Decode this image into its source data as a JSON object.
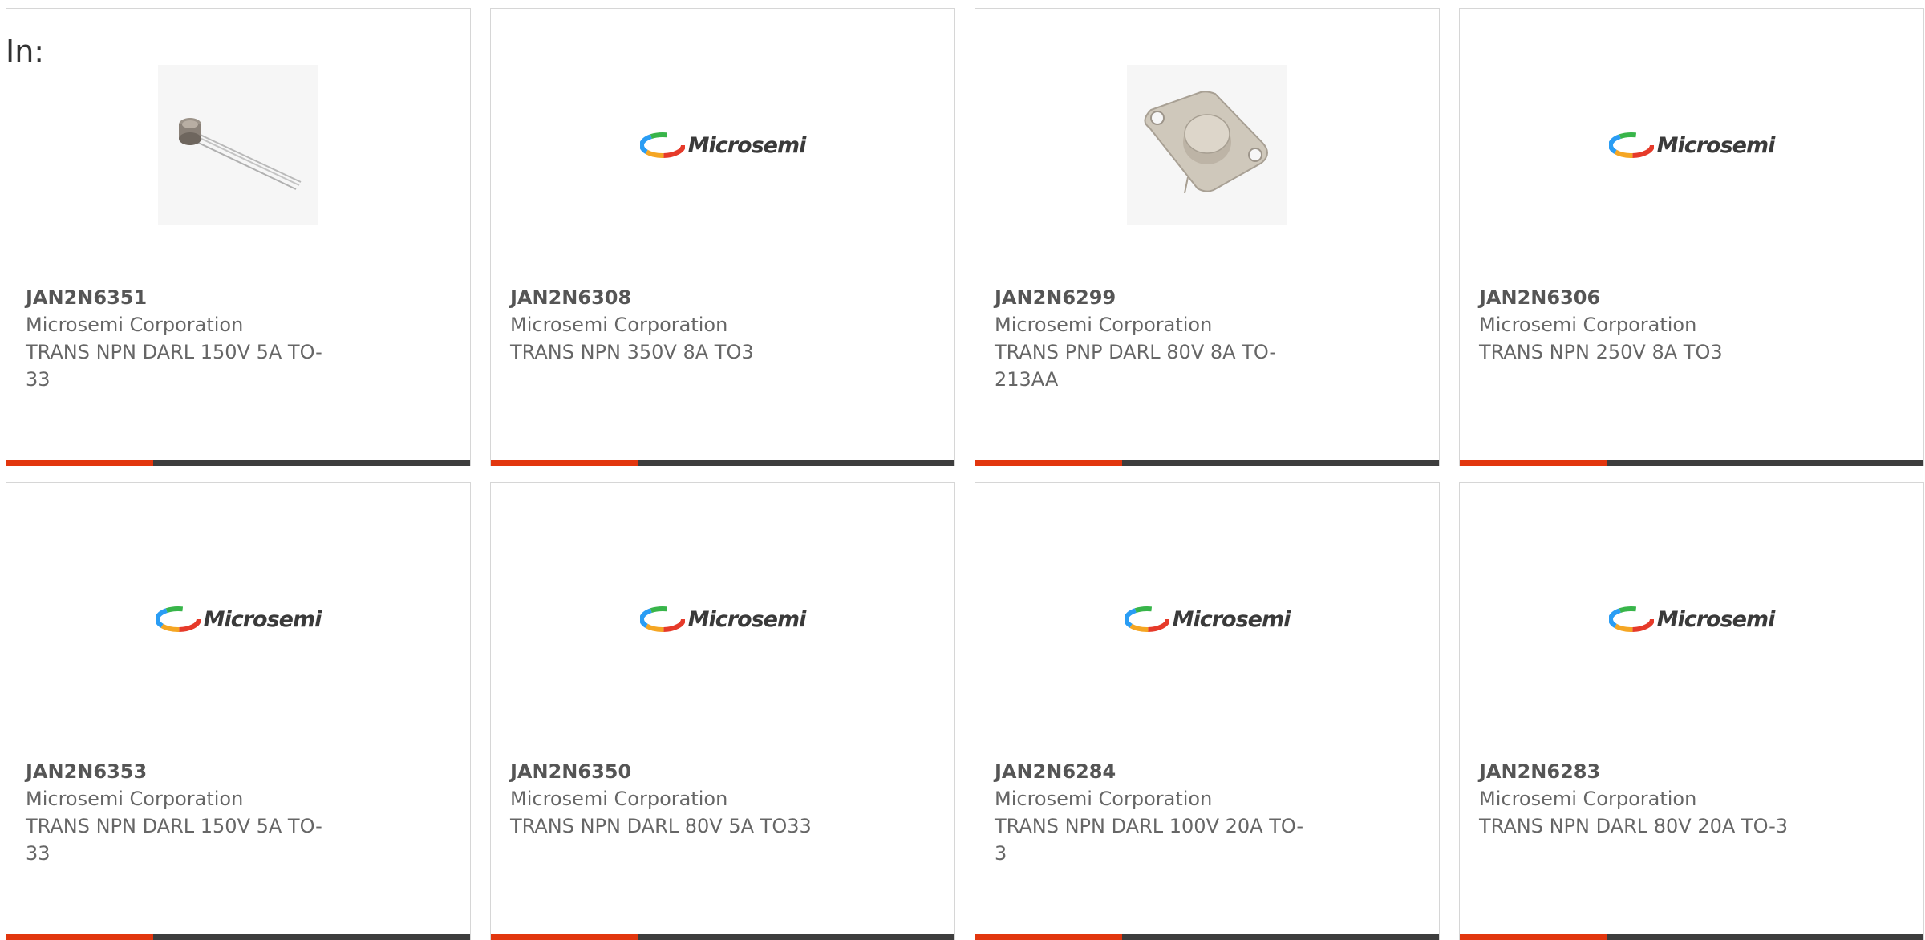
{
  "filter": {
    "label": "In:"
  },
  "logo": {
    "text": "Microsemi"
  },
  "colors": {
    "accent": "#e2360e",
    "bar": "#3d3d3d",
    "text": "#666666"
  },
  "products": [
    {
      "part_number": "JAN2N6351",
      "manufacturer": "Microsemi Corporation",
      "description": "TRANS NPN DARL 150V 5A TO-33",
      "image": "to-39-transistor-photo"
    },
    {
      "part_number": "JAN2N6308",
      "manufacturer": "Microsemi Corporation",
      "description": "TRANS NPN 350V 8A TO3",
      "image": "microsemi-logo"
    },
    {
      "part_number": "JAN2N6299",
      "manufacturer": "Microsemi Corporation",
      "description": "TRANS PNP DARL 80V 8A TO-213AA",
      "image": "to-3-transistor-photo"
    },
    {
      "part_number": "JAN2N6306",
      "manufacturer": "Microsemi Corporation",
      "description": "TRANS NPN 250V 8A TO3",
      "image": "microsemi-logo"
    },
    {
      "part_number": "JAN2N6353",
      "manufacturer": "Microsemi Corporation",
      "description": "TRANS NPN DARL 150V 5A TO-33",
      "image": "microsemi-logo"
    },
    {
      "part_number": "JAN2N6350",
      "manufacturer": "Microsemi Corporation",
      "description": "TRANS NPN DARL 80V 5A TO33",
      "image": "microsemi-logo"
    },
    {
      "part_number": "JAN2N6284",
      "manufacturer": "Microsemi Corporation",
      "description": "TRANS NPN DARL 100V 20A TO-3",
      "image": "microsemi-logo"
    },
    {
      "part_number": "JAN2N6283",
      "manufacturer": "Microsemi Corporation",
      "description": "TRANS NPN DARL 80V 20A TO-3",
      "image": "microsemi-logo"
    }
  ]
}
